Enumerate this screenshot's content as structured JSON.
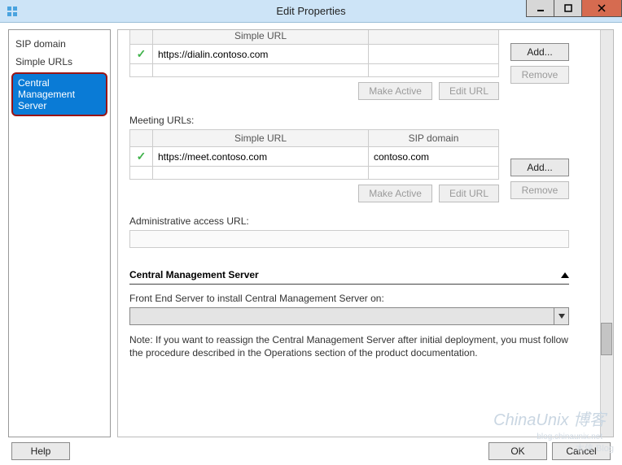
{
  "window": {
    "title": "Edit Properties"
  },
  "sidebar": {
    "items": [
      {
        "label": "SIP domain"
      },
      {
        "label": "Simple URLs"
      },
      {
        "label": "Central Management Server"
      }
    ],
    "selected_index": 2
  },
  "dialin": {
    "header_simple_url": "Simple URL",
    "rows": [
      {
        "active": true,
        "url": "https://dialin.contoso.com"
      }
    ],
    "buttons": {
      "add": "Add...",
      "remove": "Remove",
      "make_active": "Make Active",
      "edit_url": "Edit URL"
    }
  },
  "meeting": {
    "label": "Meeting URLs:",
    "headers": {
      "simple_url": "Simple URL",
      "sip_domain": "SIP domain"
    },
    "rows": [
      {
        "active": true,
        "url": "https://meet.contoso.com",
        "sip": "contoso.com"
      }
    ],
    "buttons": {
      "add": "Add...",
      "remove": "Remove",
      "make_active": "Make Active",
      "edit_url": "Edit URL"
    }
  },
  "admin": {
    "label": "Administrative access URL:",
    "value": ""
  },
  "cms": {
    "header": "Central Management Server",
    "field_label": "Front End Server to install Central Management Server on:",
    "dropdown_value": "",
    "note": "Note: If you want to reassign the Central Management Server after initial deployment, you must follow the procedure described in the Operations section of the product documentation."
  },
  "footer": {
    "help": "Help",
    "ok": "OK",
    "cancel": "Cancel"
  },
  "watermarks": {
    "w1": "ChinaUnix 博客",
    "w2": "blog.chinaunix.net",
    "w3": "木侠 Blog"
  }
}
